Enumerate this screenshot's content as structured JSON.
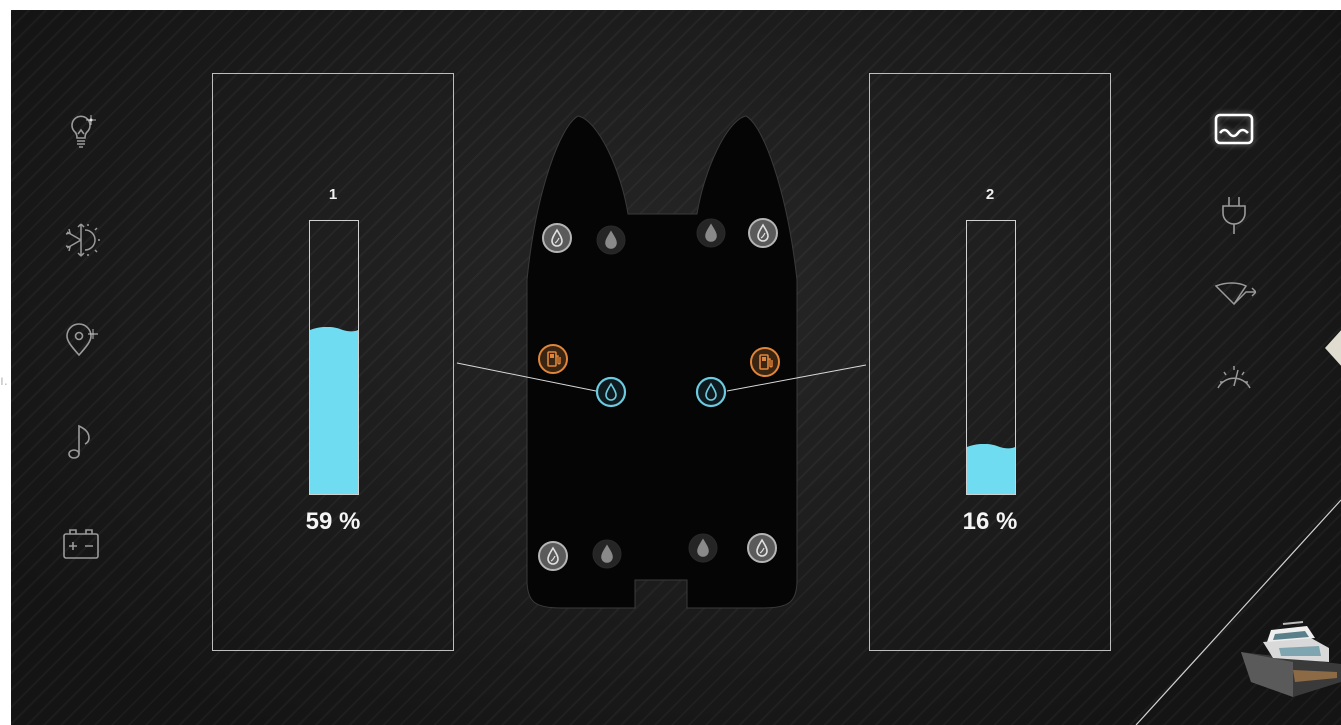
{
  "edge_text": "ı.",
  "left_nav": [
    {
      "name": "lightbulb-icon",
      "active": false
    },
    {
      "name": "climate-icon",
      "active": false
    },
    {
      "name": "location-pin-icon",
      "active": false
    },
    {
      "name": "music-note-icon",
      "active": false
    },
    {
      "name": "battery-icon",
      "active": false
    }
  ],
  "right_nav": [
    {
      "name": "water-tank-icon",
      "active": true
    },
    {
      "name": "power-plug-icon",
      "active": false
    },
    {
      "name": "windshield-wiper-icon",
      "active": false
    },
    {
      "name": "gauge-icon",
      "active": false
    }
  ],
  "tanks": [
    {
      "label": "1",
      "percent_text": "59 %",
      "level": 0.59,
      "fill_color": "#6fdcf2"
    },
    {
      "label": "2",
      "percent_text": "16 %",
      "level": 0.16,
      "fill_color": "#6fdcf2"
    }
  ],
  "sensors": [
    {
      "name": "greywater-sensor-icon",
      "style": "grey"
    },
    {
      "name": "blackwater-sensor-icon",
      "style": "dark"
    },
    {
      "name": "blackwater-sensor-icon",
      "style": "dark"
    },
    {
      "name": "greywater-sensor-icon",
      "style": "grey"
    },
    {
      "name": "fuel-sensor-icon",
      "style": "orange"
    },
    {
      "name": "freshwater-sensor-icon",
      "style": "blue"
    },
    {
      "name": "freshwater-sensor-icon",
      "style": "blue"
    },
    {
      "name": "fuel-sensor-icon",
      "style": "orange"
    },
    {
      "name": "greywater-sensor-icon",
      "style": "grey"
    },
    {
      "name": "blackwater-sensor-icon",
      "style": "dark"
    },
    {
      "name": "blackwater-sensor-icon",
      "style": "dark"
    },
    {
      "name": "greywater-sensor-icon",
      "style": "grey"
    }
  ],
  "colors": {
    "accent_water": "#6fdcf2",
    "fuel": "#e0853a",
    "freshwater_ring": "#6ccbe0",
    "icon_inactive": "#9a9a9a",
    "icon_active": "#ffffff"
  }
}
